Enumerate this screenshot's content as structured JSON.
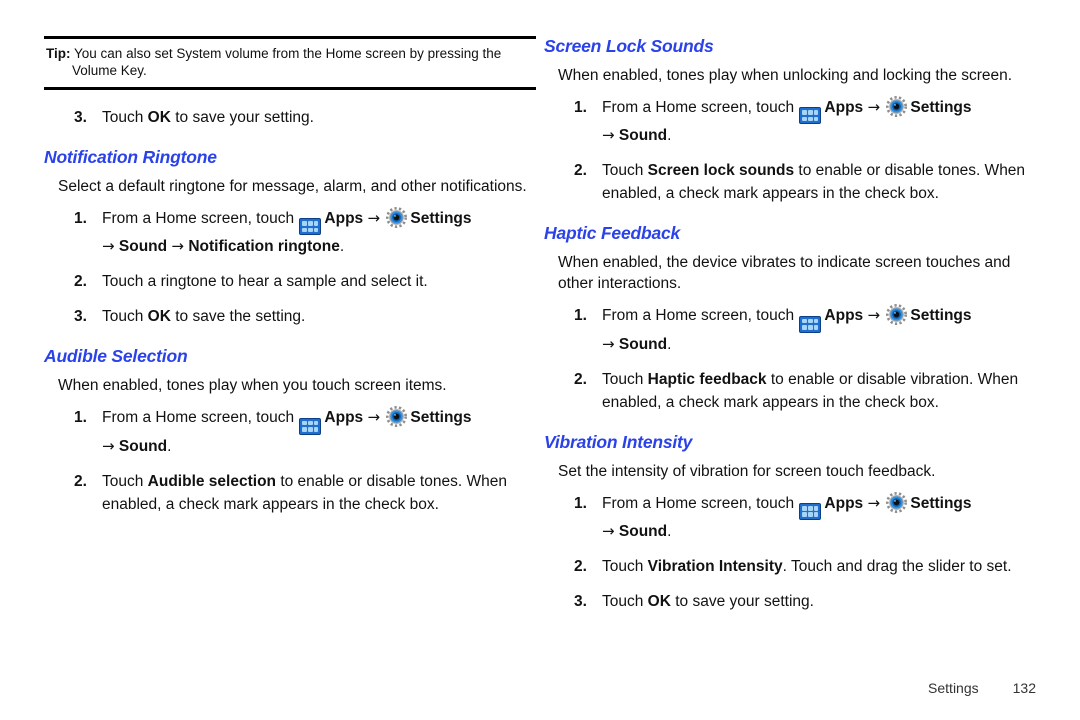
{
  "document": {
    "footer": {
      "section_label": "Settings",
      "page_number": "132"
    },
    "accent_heading_color": "#2a42e8",
    "icons": {
      "apps": "apps-grid-icon",
      "settings": "gear-icon",
      "arrow": "→"
    }
  },
  "tip": {
    "label": "Tip:",
    "text": "You can also set System volume from the Home screen by pressing the Volume Key."
  },
  "left_column": {
    "lead_step": {
      "num": "3.",
      "pre": "Touch ",
      "bold": "OK",
      "post": " to save your setting."
    },
    "sections": [
      {
        "heading": "Notification Ringtone",
        "body": "Select a default ringtone for message, alarm, and other notifications.",
        "steps": [
          {
            "num": "1.",
            "pre": "From a Home screen, touch ",
            "apps_label": "Apps",
            "arrow1": "→",
            "settings_label": "Settings",
            "sub_arrow1": "→",
            "sub_bold1": "Sound",
            "sub_arrow2": "→",
            "sub_bold2": "Notification ringtone",
            "sub_post": "."
          },
          {
            "num": "2.",
            "pre": "Touch a ringtone to hear a sample and select it."
          },
          {
            "num": "3.",
            "pre": "Touch ",
            "bold": "OK",
            "post": " to save the setting."
          }
        ]
      },
      {
        "heading": "Audible Selection",
        "body": "When enabled, tones play when you touch screen items.",
        "steps": [
          {
            "num": "1.",
            "pre": "From a Home screen, touch ",
            "apps_label": "Apps",
            "arrow1": "→",
            "settings_label": "Settings",
            "sub_arrow1": "→",
            "sub_bold1": "Sound",
            "sub_post": "."
          },
          {
            "num": "2.",
            "pre": "Touch ",
            "bold": "Audible selection",
            "post": " to enable or disable tones. When enabled, a check mark appears in the check box."
          }
        ]
      }
    ]
  },
  "right_column": {
    "sections": [
      {
        "heading": "Screen Lock Sounds",
        "body": "When enabled, tones play when unlocking and locking the screen.",
        "steps": [
          {
            "num": "1.",
            "pre": "From a Home screen, touch ",
            "apps_label": "Apps",
            "arrow1": "→",
            "settings_label": "Settings",
            "sub_arrow1": "→",
            "sub_bold1": "Sound",
            "sub_post": "."
          },
          {
            "num": "2.",
            "pre": "Touch ",
            "bold": "Screen lock sounds",
            "post": " to enable or disable tones. When enabled, a check mark appears in the check box."
          }
        ]
      },
      {
        "heading": "Haptic Feedback",
        "body": "When enabled, the device vibrates to indicate screen touches and other interactions.",
        "steps": [
          {
            "num": "1.",
            "pre": "From a Home screen, touch ",
            "apps_label": "Apps",
            "arrow1": "→",
            "settings_label": "Settings",
            "sub_arrow1": "→",
            "sub_bold1": "Sound",
            "sub_post": "."
          },
          {
            "num": "2.",
            "pre": "Touch ",
            "bold": "Haptic feedback",
            "post": " to enable or disable vibration. When enabled, a check mark appears in the check box."
          }
        ]
      },
      {
        "heading": "Vibration Intensity",
        "body": "Set the intensity of vibration for screen touch feedback.",
        "steps": [
          {
            "num": "1.",
            "pre": "From a Home screen, touch ",
            "apps_label": "Apps",
            "arrow1": "→",
            "settings_label": "Settings",
            "sub_arrow1": "→",
            "sub_bold1": "Sound",
            "sub_post": "."
          },
          {
            "num": "2.",
            "pre": "Touch ",
            "bold": "Vibration Intensity",
            "post": ". Touch and drag the slider to set."
          },
          {
            "num": "3.",
            "pre": "Touch ",
            "bold": "OK",
            "post": " to save your setting."
          }
        ]
      }
    ]
  }
}
